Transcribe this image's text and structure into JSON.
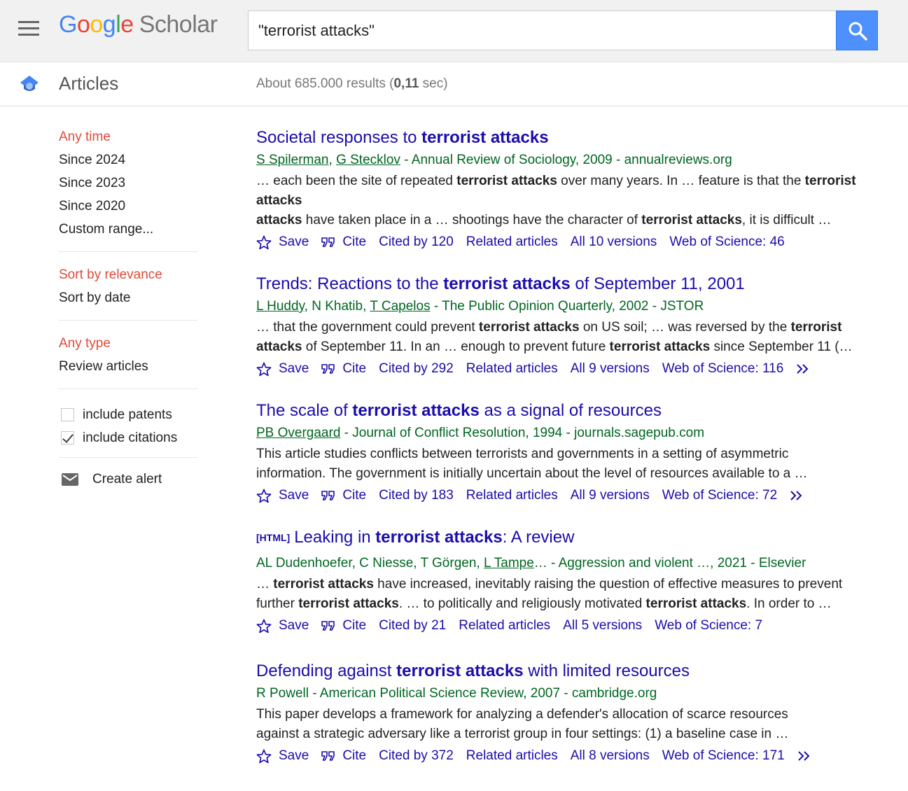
{
  "header": {
    "logo_letters": [
      "G",
      "o",
      "o",
      "g",
      "l",
      "e"
    ],
    "logo_product": "Scholar",
    "search_value": "\"terrorist attacks\""
  },
  "subheader": {
    "section": "Articles",
    "results_prefix": "About 685.000 results (",
    "results_time": "0,11",
    "results_suffix": " sec)"
  },
  "sidebar": {
    "time_filters": [
      "Any time",
      "Since 2024",
      "Since 2023",
      "Since 2020",
      "Custom range..."
    ],
    "sort_filters": [
      "Sort by relevance",
      "Sort by date"
    ],
    "type_filters": [
      "Any type",
      "Review articles"
    ],
    "include_patents": "include patents",
    "include_citations": "include citations",
    "create_alert": "Create alert"
  },
  "link_labels": {
    "save": "Save",
    "cite": "Cite",
    "related": "Related articles"
  },
  "results": [
    {
      "title_pre": "Societal responses to ",
      "title_bold": "terrorist attacks",
      "title_post": "",
      "authors": [
        "S Spilerman",
        "G Stecklov"
      ],
      "meta_post": " - Annual Review of Sociology, 2009 - annualreviews.org",
      "snippet_1a": "… each been the site of repeated ",
      "snippet_1b": "terrorist attacks",
      "snippet_1c": " over many years. In … feature is that the ",
      "snippet_1d": "terrorist attacks",
      "snippet_2a": " have taken place in a … shootings have the character of ",
      "snippet_2b": "terrorist attacks",
      "snippet_2c": ", it is difficult …",
      "cited_by": "Cited by 120",
      "versions": "All 10 versions",
      "wos": "Web of Science: 46"
    },
    {
      "title_pre": "Trends: Reactions to the ",
      "title_bold": "terrorist attacks",
      "title_post": " of September 11, 2001",
      "authors_line_a": "L Huddy",
      "authors_line_b": ", N Khatib, ",
      "authors_line_c": "T Capelos",
      "meta_post": " - The Public Opinion Quarterly, 2002 - JSTOR",
      "snippet_1a": "… that the government could prevent ",
      "snippet_1b": "terrorist attacks",
      "snippet_1c": " on US soil; … was reversed by the ",
      "snippet_1d": "terrorist",
      "snippet_2pre": "attacks",
      "snippet_2a": " of September 11. In an … enough to prevent future ",
      "snippet_2b": "terrorist attacks",
      "snippet_2c": " since September 11 (…",
      "cited_by": "Cited by 292",
      "versions": "All 9 versions",
      "wos": "Web of Science: 116"
    },
    {
      "title_pre": "The scale of ",
      "title_bold": "terrorist attacks",
      "title_post": " as a signal of resources",
      "author": "PB Overgaard",
      "meta_post": " - Journal of Conflict Resolution, 1994 - journals.sagepub.com",
      "snippet_1": "This article studies conflicts between terrorists and governments in a setting of asymmetric",
      "snippet_2": "information. The government is initially uncertain about the level of resources available to a …",
      "cited_by": "Cited by 183",
      "versions": "All 9 versions",
      "wos": "Web of Science: 72"
    },
    {
      "tag": "[HTML]",
      "title_pre": "Leaking in ",
      "title_bold": "terrorist attacks",
      "title_post": ": A review",
      "meta_pre": "AL Dudenhoefer, C Niesse, T Görgen, ",
      "author": "L Tampe",
      "meta_post": "… - Aggression and violent …, 2021 - Elsevier",
      "snippet_1a": "… ",
      "snippet_1b": "terrorist attacks",
      "snippet_1c": " have increased, inevitably raising the question of effective measures to prevent",
      "snippet_2pre": "further ",
      "snippet_2b": "terrorist attacks",
      "snippet_2c": ". … to politically and religiously motivated ",
      "snippet_2d": "terrorist attacks",
      "snippet_2e": ". In order to …",
      "cited_by": "Cited by 21",
      "versions": "All 5 versions",
      "wos": "Web of Science: 7"
    },
    {
      "title_pre": "Defending against ",
      "title_bold": "terrorist attacks",
      "title_post": " with limited resources",
      "meta": "R Powell - American Political Science Review, 2007 - cambridge.org",
      "snippet_1": "This paper develops a framework for analyzing a defender's allocation of scarce resources",
      "snippet_2": "against a strategic adversary like a terrorist group in four settings: (1) a baseline case in …",
      "cited_by": "Cited by 372",
      "versions": "All 8 versions",
      "wos": "Web of Science: 171"
    }
  ],
  "colors": {
    "link": "#1a0dab",
    "meta_green": "#006621",
    "active_filter": "#dd4b39",
    "search_button": "#4d90fe"
  },
  "icons": [
    "menu-icon",
    "search-icon",
    "scholar-cap-icon",
    "star-icon",
    "quote-icon",
    "double-chevron-icon",
    "envelope-icon"
  ]
}
